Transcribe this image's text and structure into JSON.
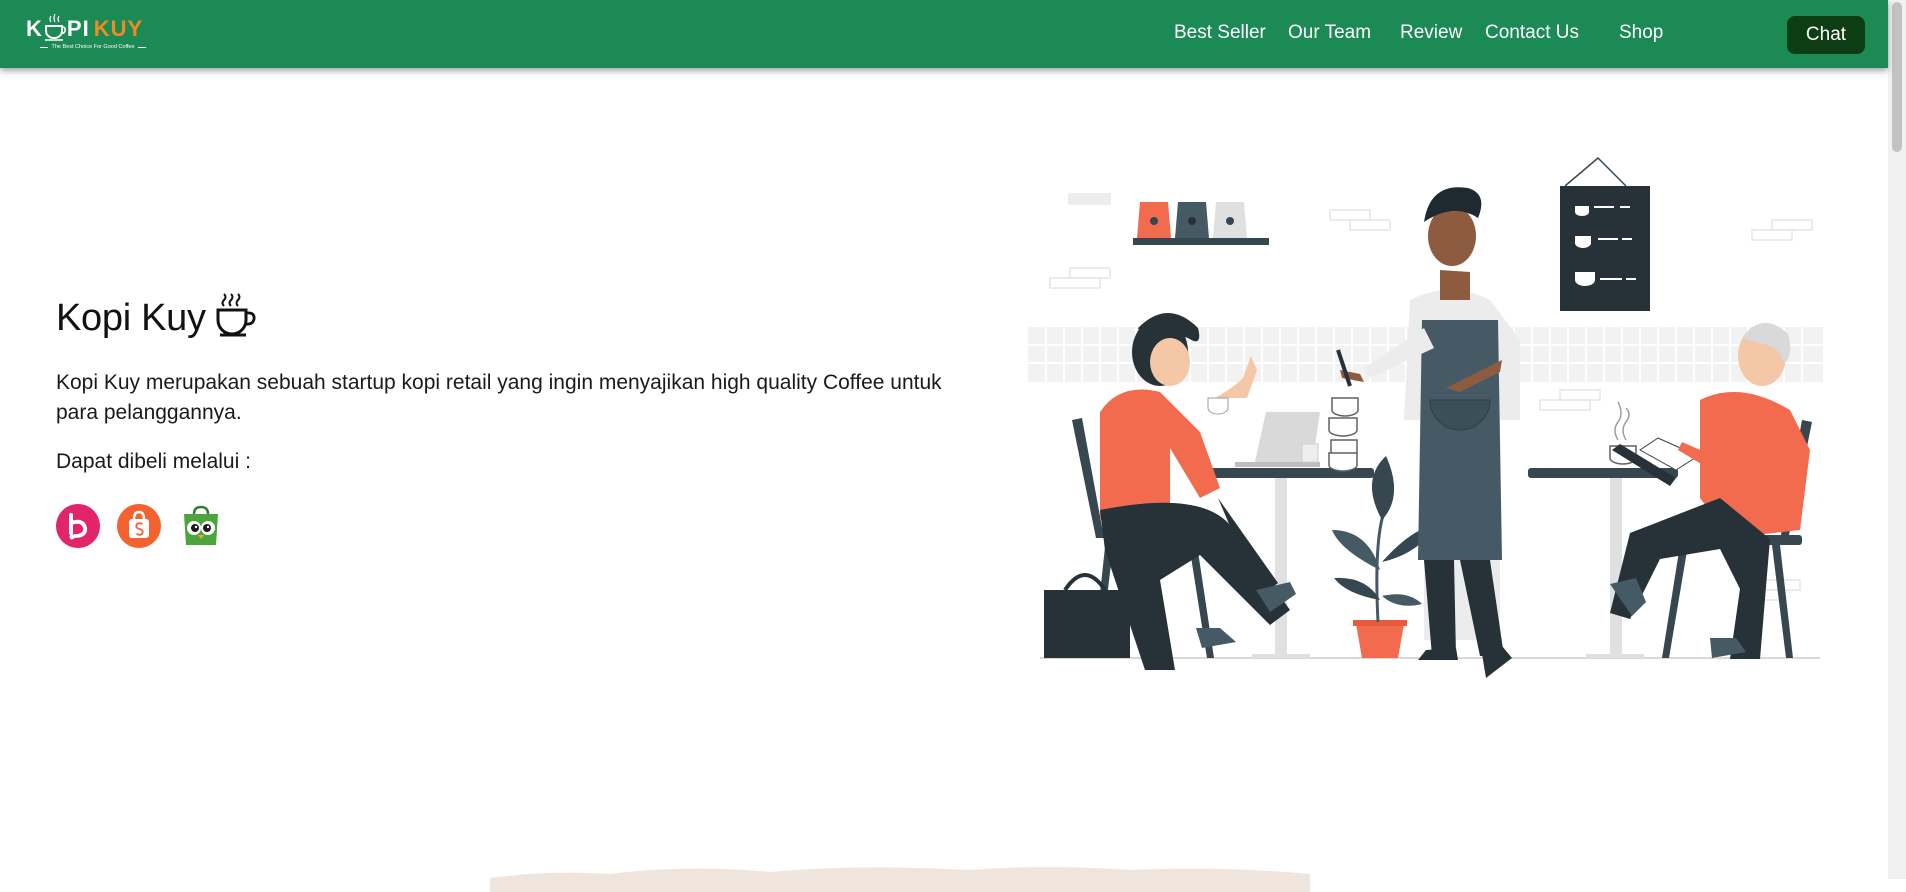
{
  "brand": {
    "logo_left": "K",
    "logo_mid": "PI",
    "logo_right": "KUY",
    "tagline": "The Best Choice For Good Coffee"
  },
  "nav": {
    "links": [
      "Best Seller",
      "Our Team",
      "Review",
      "Contact Us",
      "Shop"
    ],
    "chat_label": "Chat"
  },
  "hero": {
    "title": "Kopi Kuy",
    "title_icon": "coffee-cup-icon",
    "description": "Kopi Kuy merupakan sebuah startup kopi retail yang ingin menyajikan high quality Coffee untuk para pelanggannya.",
    "buy_label": "Dapat dibeli melalui :",
    "stores": [
      {
        "icon": "blibli-icon",
        "color": "#e2246b"
      },
      {
        "icon": "shopee-icon",
        "color": "#f4622f"
      },
      {
        "icon": "tokopedia-icon",
        "color": "#4aa53d"
      }
    ]
  },
  "colors": {
    "navbar": "#1c8a55",
    "chat_button": "#0d3d12",
    "accent_orange": "#f08a24",
    "illustration_coral": "#f26b4f",
    "illustration_dark": "#37474f"
  }
}
